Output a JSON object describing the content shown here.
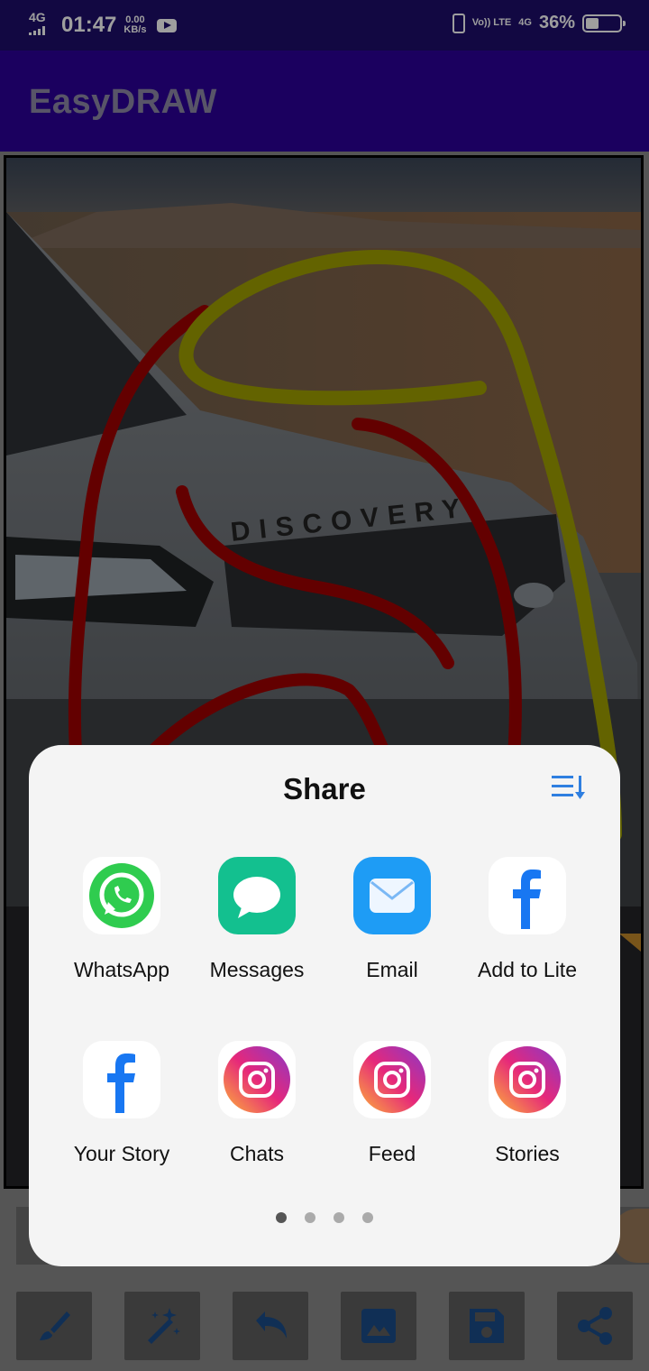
{
  "status_bar": {
    "network": "4G",
    "time": "01:47",
    "speed_value": "0.00",
    "speed_unit": "KB/s",
    "volte": "Vo)) LTE",
    "network_right": "4G",
    "battery_percent": "36%",
    "battery_level": 0.36
  },
  "app": {
    "title": "EasyDRAW",
    "bar_color": "#2c0099"
  },
  "canvas": {
    "image_subject": "Land Rover Discovery front",
    "hood_text": "DISCOVERY",
    "strokes": [
      {
        "color": "#a00000",
        "label": "red stroke"
      },
      {
        "color": "#a0a000",
        "label": "yellow stroke"
      }
    ]
  },
  "share_sheet": {
    "title": "Share",
    "sort_icon": "sort-list-icon",
    "apps": [
      {
        "label": "WhatsApp",
        "icon": "whatsapp-icon"
      },
      {
        "label": "Messages",
        "icon": "messages-icon"
      },
      {
        "label": "Email",
        "icon": "email-icon"
      },
      {
        "label": "Add to Lite",
        "icon": "facebook-icon"
      },
      {
        "label": "Your Story",
        "icon": "facebook-icon"
      },
      {
        "label": "Chats",
        "icon": "instagram-icon"
      },
      {
        "label": "Feed",
        "icon": "instagram-icon"
      },
      {
        "label": "Stories",
        "icon": "instagram-icon"
      }
    ],
    "page_count": 4,
    "current_page": 1
  },
  "toolbar": {
    "buttons": [
      {
        "icon": "brush-icon"
      },
      {
        "icon": "magic-wand-icon"
      },
      {
        "icon": "undo-icon"
      },
      {
        "icon": "image-icon"
      },
      {
        "icon": "save-icon"
      },
      {
        "icon": "share-icon"
      }
    ]
  }
}
